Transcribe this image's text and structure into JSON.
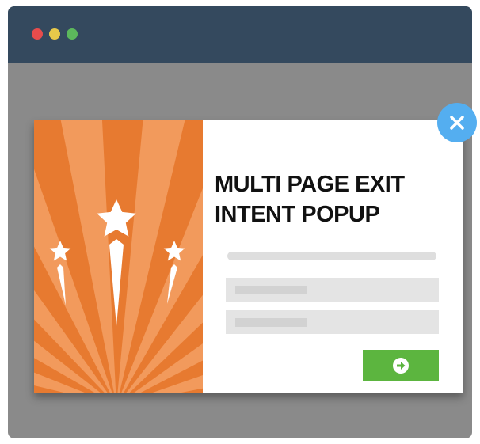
{
  "window": {
    "traffic_lights": [
      "close-dot",
      "minimize-dot",
      "maximize-dot"
    ]
  },
  "popup": {
    "title": "MULTI PAGE EXIT INTENT POPUP",
    "hero_icon": "shooting-stars-icon",
    "submit_icon": "arrow-right-icon",
    "close_icon": "close-icon"
  },
  "colors": {
    "title_bar": "#34495e",
    "window_body": "#8a8a8a",
    "hero_orange": "#e77a30",
    "submit_green": "#5cb53f",
    "close_blue": "#54aef0",
    "dot_red": "#e74c4c",
    "dot_yellow": "#e6c84a",
    "dot_green": "#5cb85c"
  }
}
